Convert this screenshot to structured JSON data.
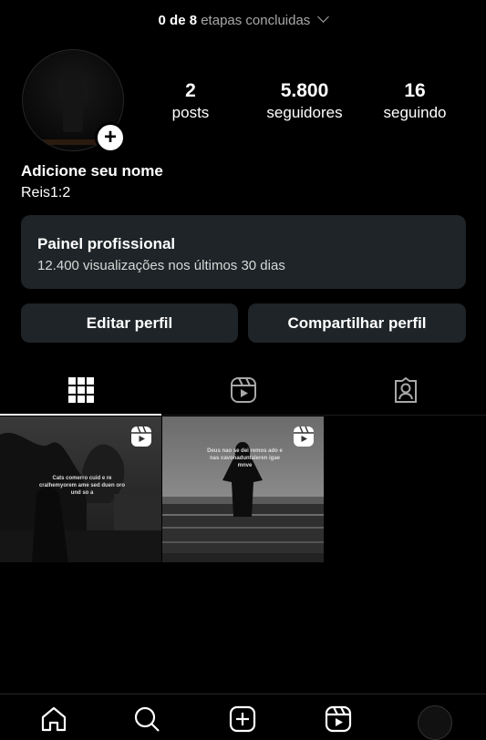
{
  "top": {
    "progress_bold": "0 de 8",
    "progress_rest": "etapas concluidas"
  },
  "profile": {
    "name": "Adicione seu nome",
    "bio": "Reis1:2"
  },
  "stats": [
    {
      "num": "2",
      "label": "posts"
    },
    {
      "num": "5.800",
      "label": "seguidores"
    },
    {
      "num": "16",
      "label": "seguindo"
    }
  ],
  "panel": {
    "title": "Painel profissional",
    "subtitle": "12.400 visualizações nos últimos 30 dias"
  },
  "buttons": {
    "edit": "Editar perfil",
    "share": "Compartilhar perfil"
  },
  "tabs": [
    "grid-icon",
    "reels-icon",
    "tagged-icon"
  ],
  "posts": [
    {
      "caption": "Cats comerro cuid e re cralhemyorem ame sed duen oro und so a"
    },
    {
      "caption": "Deus nao se dei remos ado e nas cavonaduntaleren igae mnve"
    }
  ],
  "nav": [
    "home-icon",
    "search-icon",
    "create-icon",
    "reels-icon",
    "profile-icon"
  ],
  "colors": {
    "background": "#000000",
    "card": "#1e2427",
    "text": "#ffffff",
    "muted": "#a8a8a8"
  }
}
